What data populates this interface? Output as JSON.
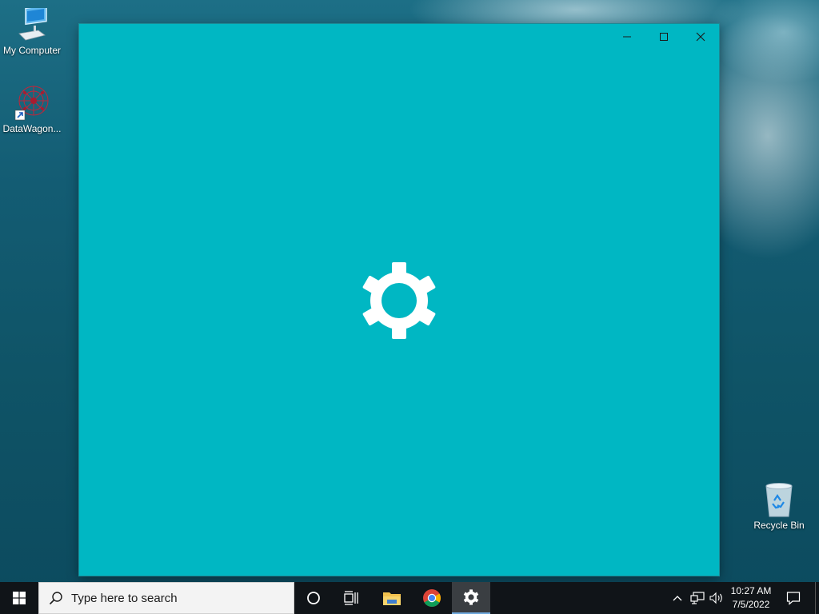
{
  "desktop": {
    "icons": [
      {
        "label": "My Computer",
        "icon": "computer-icon"
      },
      {
        "label": "DataWagon...",
        "icon": "datawagon-icon"
      },
      {
        "label": "Recycle Bin",
        "icon": "recycle-bin-icon"
      }
    ]
  },
  "window": {
    "background_color": "#00b7c3",
    "controls": {
      "minimize": "minimize-icon",
      "maximize": "maximize-icon",
      "close": "close-icon"
    },
    "splash_icon": "gear-icon"
  },
  "taskbar": {
    "start_icon": "windows-logo-icon",
    "search_placeholder": "Type here to search",
    "pinned": [
      {
        "name": "cortana",
        "icon": "cortana-icon"
      },
      {
        "name": "task-view",
        "icon": "task-view-icon"
      },
      {
        "name": "file-explorer",
        "icon": "folder-icon"
      },
      {
        "name": "chrome",
        "icon": "chrome-icon"
      },
      {
        "name": "settings",
        "icon": "gear-icon",
        "active": true
      }
    ],
    "tray": {
      "time": "10:27 AM",
      "date": "7/5/2022"
    }
  }
}
